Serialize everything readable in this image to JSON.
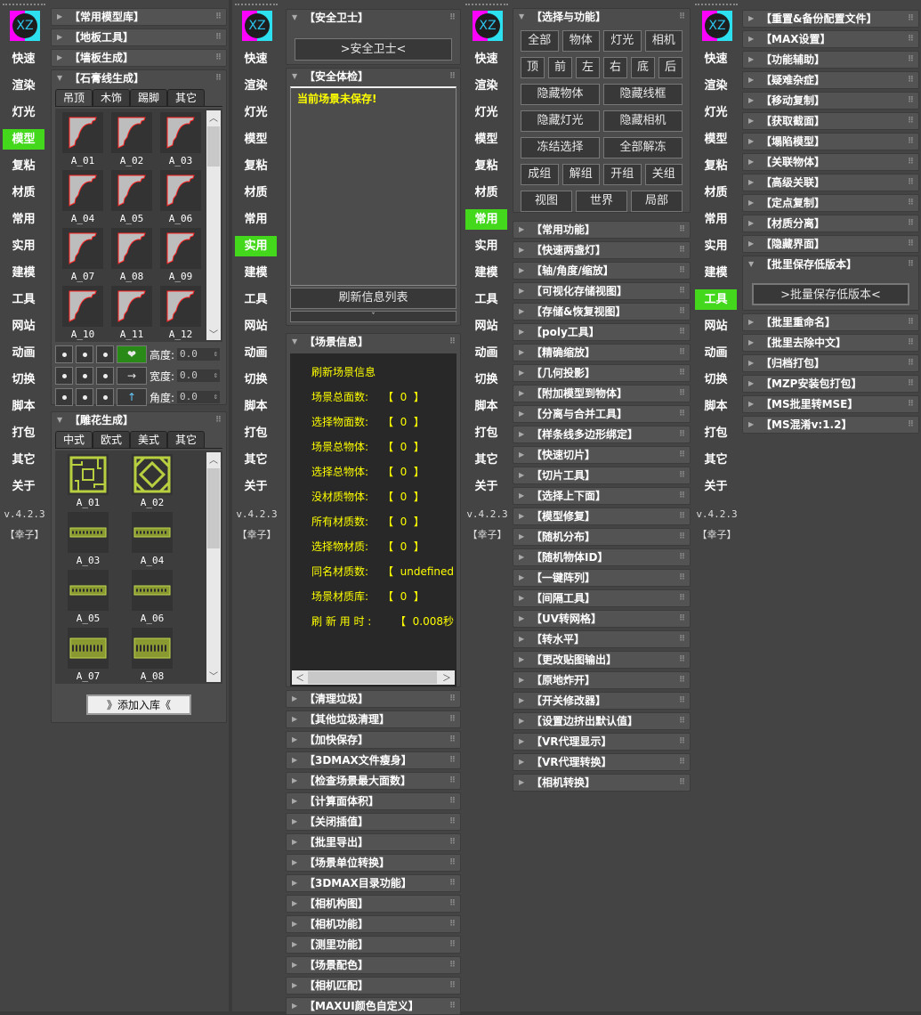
{
  "sidebar": {
    "logo": "XZ",
    "items": [
      "快速",
      "渲染",
      "灯光",
      "模型",
      "复粘",
      "材质",
      "常用",
      "实用",
      "建模",
      "工具",
      "网站",
      "动画",
      "切换",
      "脚本",
      "打包",
      "其它",
      "关于"
    ],
    "version": "v.4.2.3",
    "author": "【幸子】"
  },
  "colors": {
    "active": "#44d81c",
    "warn_text": "#ffff00"
  },
  "panels": [
    {
      "active": 3,
      "collapsed_top": [
        "【常用模型库】",
        "【地板工具】",
        "【墙板生成】"
      ],
      "molding": {
        "title": "【石膏线生成】",
        "tabs": [
          "吊顶",
          "木饰",
          "踢脚",
          "其它"
        ],
        "items": [
          "A_01",
          "A_02",
          "A_03",
          "A_04",
          "A_05",
          "A_06",
          "A_07",
          "A_08",
          "A_09",
          "A_10",
          "A_11",
          "A_12"
        ],
        "labels": {
          "height": "高度:",
          "width": "宽度:",
          "angle": "角度:"
        },
        "values": {
          "height": "0.0",
          "width": "0.0",
          "angle": "0.0"
        },
        "arrow_right": "→",
        "arrow_up": "↑"
      },
      "carving": {
        "title": "【雕花生成】",
        "tabs": [
          "中式",
          "欧式",
          "美式",
          "其它"
        ],
        "items": [
          "A_01",
          "A_02",
          "A_03",
          "A_04",
          "A_05",
          "A_06",
          "A_07",
          "A_08"
        ],
        "add_button": "》添加入库《"
      }
    },
    {
      "active": 7,
      "guard": {
        "title": "【安全卫士】",
        "button": ">安全卫士<"
      },
      "check": {
        "title": "【安全体检】",
        "warning": "当前场景未保存!",
        "refresh_button": "刷新信息列表",
        "more": "ˇ"
      },
      "scene": {
        "title": "【场景信息】",
        "refresh": "刷新场景信息",
        "rows": [
          [
            "场景总面数:",
            "【  0  】"
          ],
          [
            "选择物面数:",
            "【  0  】"
          ],
          [
            "场景总物体:",
            "【  0  】"
          ],
          [
            "选择总物体:",
            "【  0  】"
          ],
          [
            "没材质物体:",
            "【  0  】"
          ],
          [
            "所有材质数:",
            "【  0  】"
          ],
          [
            "选择物材质:",
            "【  0  】"
          ],
          [
            "同名材质数:",
            "【  undefined"
          ],
          [
            "场景材质库:",
            "【  0  】"
          ],
          [
            "刷 新 用 时 :",
            "【  0.008秒"
          ]
        ]
      },
      "collapsed": [
        "【清理垃圾】",
        "【其他垃圾清理】",
        "【加快保存】",
        "【3DMAX文件瘦身】",
        "【检查场景最大面数】",
        "【计算面体积】",
        "【关闭插值】",
        "【批里导出】",
        "【场景单位转换】",
        "【3DMAX目录功能】",
        "【相机构图】",
        "【相机功能】",
        "【测里功能】",
        "【场景配色】",
        "【相机匹配】",
        "【MAXUI颜色自定义】"
      ]
    },
    {
      "active": 6,
      "select": {
        "title": "【选择与功能】",
        "rows": [
          [
            "全部",
            "物体",
            "灯光",
            "相机"
          ],
          [
            "顶",
            "前",
            "左",
            "右",
            "底",
            "后"
          ],
          [
            "隐藏物体",
            "隐藏线框"
          ],
          [
            "隐藏灯光",
            "隐藏相机"
          ],
          [
            "冻结选择",
            "全部解冻"
          ],
          [
            "成组",
            "解组",
            "开组",
            "关组"
          ],
          [
            "视图",
            "世界",
            "局部"
          ]
        ]
      },
      "collapsed": [
        "【常用功能】",
        "【快速两盏灯】",
        "【轴/角度/缩放】",
        "【可视化存储视图】",
        "【存储&恢复视图】",
        "【poly工具】",
        "【精确缩放】",
        "【几何投影】",
        "【附加模型到物体】",
        "【分离与合并工具】",
        "【样条线多边形绑定】",
        "【快速切片】",
        "【切片工具】",
        "【选择上下面】",
        "【模型修复】",
        "【随机分布】",
        "【随机物体ID】",
        "【一键阵列】",
        "【间隔工具】",
        "【UV转网格】",
        "【转水平】",
        "【更改贴图输出】",
        "【原地炸开】",
        "【开关修改器】",
        "【设置边挤出默认值】",
        "【VR代理显示】",
        "【VR代理转换】",
        "【相机转换】"
      ]
    },
    {
      "active": 9,
      "collapsed_top": [
        "【重置&备份配置文件】",
        "【MAX设置】",
        "【功能辅助】",
        "【疑难杂症】",
        "【移动复制】",
        "【获取截面】",
        "【塌陷模型】",
        "【关联物体】",
        "【高级关联】",
        "【定点复制】",
        "【材质分离】",
        "【隐藏界面】"
      ],
      "batch": {
        "title": "【批里保存低版本】",
        "button": ">批量保存低版本<"
      },
      "collapsed_bottom": [
        "【批里重命名】",
        "【批里去除中文】",
        "【归档打包】",
        "【MZP安装包打包】",
        "【MS批里转MSE】",
        "【MS混淆v:1.2】"
      ]
    }
  ]
}
